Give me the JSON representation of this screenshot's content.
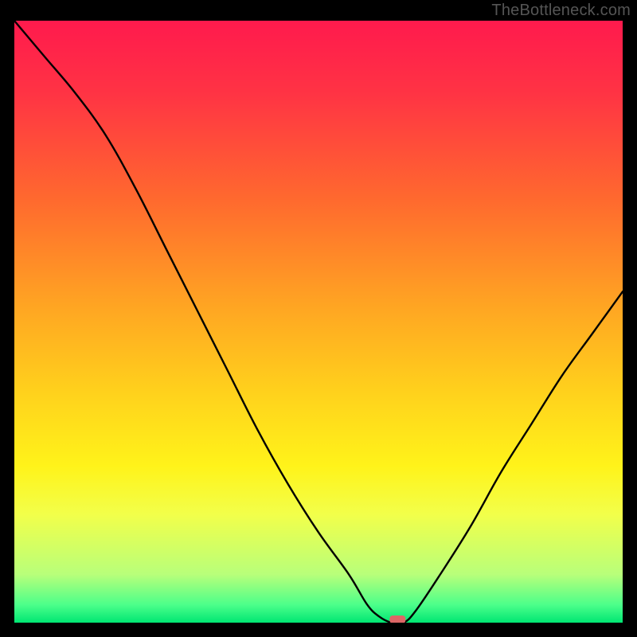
{
  "watermark": "TheBottleneck.com",
  "chart_data": {
    "type": "line",
    "title": "",
    "xlabel": "",
    "ylabel": "",
    "xlim": [
      0,
      100
    ],
    "ylim": [
      0,
      100
    ],
    "grid": false,
    "curve_description": "Asymmetric notch / V-shaped curve on a red-to-green vertical heat gradient. Curve starts at top-left (~100), descends steeply, reaches ~0 near x≈63, then rises again toward ~55 at right edge.",
    "series": [
      {
        "name": "bottleneck-curve",
        "x": [
          0,
          5,
          10,
          15,
          20,
          25,
          30,
          35,
          40,
          45,
          50,
          55,
          58,
          60,
          62,
          64,
          66,
          70,
          75,
          80,
          85,
          90,
          95,
          100
        ],
        "values": [
          100,
          94,
          88,
          81,
          72,
          62,
          52,
          42,
          32,
          23,
          15,
          8,
          3,
          1,
          0,
          0,
          2,
          8,
          16,
          25,
          33,
          41,
          48,
          55
        ]
      }
    ],
    "minimum_marker": {
      "x": 63,
      "y": 0
    },
    "background_gradient": {
      "orientation": "vertical",
      "stops": [
        {
          "offset": 0.0,
          "color": "#ff1a4d"
        },
        {
          "offset": 0.12,
          "color": "#ff3344"
        },
        {
          "offset": 0.3,
          "color": "#ff6a2e"
        },
        {
          "offset": 0.48,
          "color": "#ffa722"
        },
        {
          "offset": 0.62,
          "color": "#ffd21c"
        },
        {
          "offset": 0.74,
          "color": "#fff31a"
        },
        {
          "offset": 0.82,
          "color": "#f2ff4a"
        },
        {
          "offset": 0.92,
          "color": "#b8ff7a"
        },
        {
          "offset": 0.97,
          "color": "#4dff8a"
        },
        {
          "offset": 1.0,
          "color": "#00e673"
        }
      ]
    }
  }
}
